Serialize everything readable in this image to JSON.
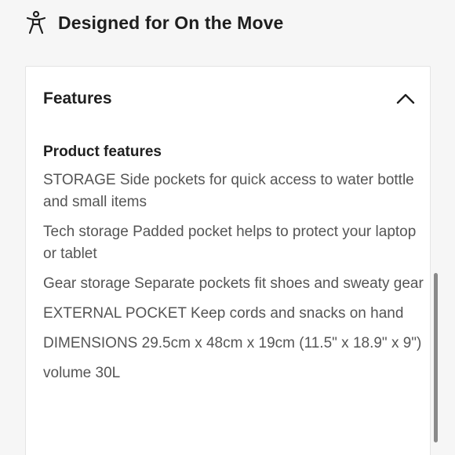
{
  "header": {
    "title": "Designed for On the Move",
    "icon": "accessibility-person-icon"
  },
  "accordion": {
    "title": "Features",
    "expanded": true,
    "toggle_icon": "chevron-up-icon",
    "section_title": "Product features",
    "items": [
      "STORAGE Side pockets for quick access to water bottle and small items",
      "Tech storage Padded pocket helps to protect your laptop or tablet",
      "Gear storage Separate pockets fit shoes and sweaty gear",
      "EXTERNAL POCKET Keep cords and snacks on hand",
      "DIMENSIONS 29.5cm x 48cm x 19cm (11.5\" x 18.9\" x 9\")",
      "volume 30L"
    ]
  },
  "colors": {
    "background": "#f6f6f6",
    "card": "#ffffff",
    "text_primary": "#1f1f1f",
    "text_secondary": "#555555",
    "scrollbar": "#8a8a8a"
  }
}
